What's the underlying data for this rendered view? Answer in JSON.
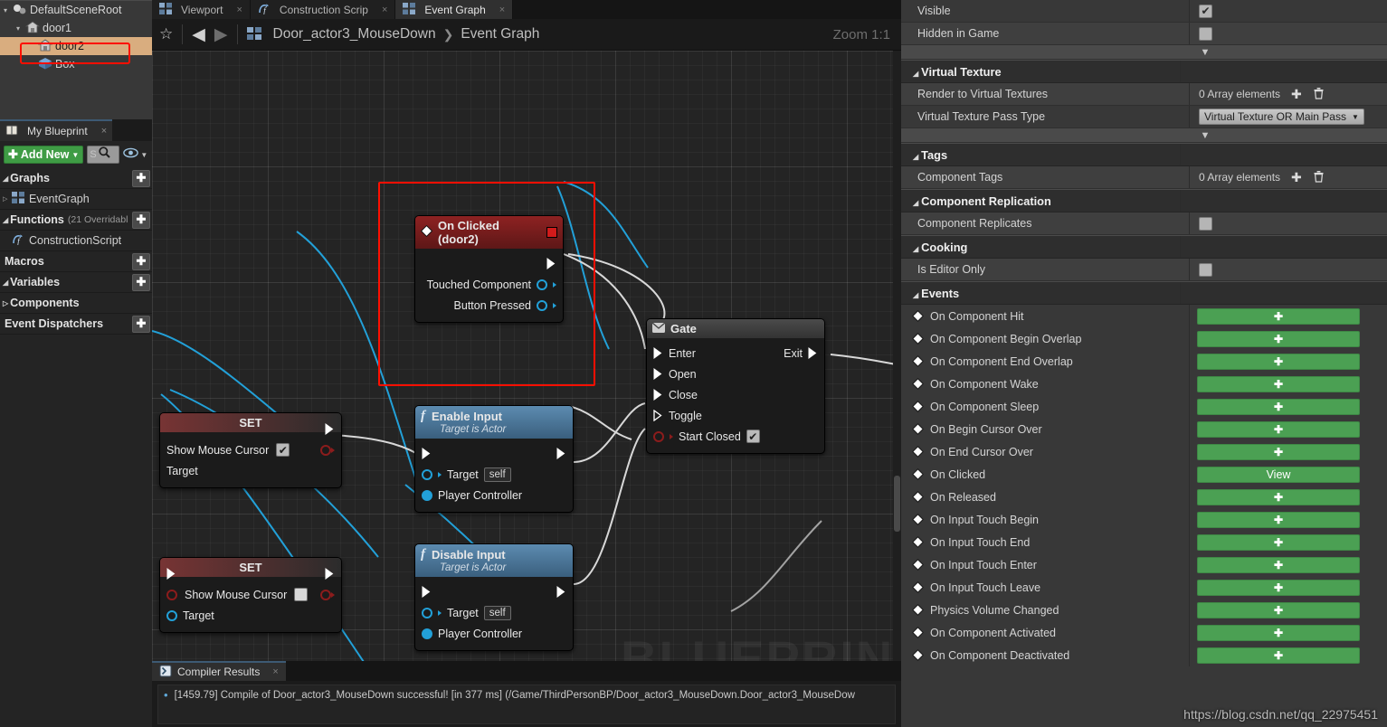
{
  "outliner": {
    "rows": [
      {
        "label": "DefaultSceneRoot",
        "icon": "scene-root-icon",
        "indent": 10,
        "expander": "▾",
        "selected": false
      },
      {
        "label": "door1",
        "icon": "mesh-icon",
        "indent": 24,
        "expander": "▾",
        "selected": false
      },
      {
        "label": "door2",
        "icon": "mesh-icon",
        "indent": 38,
        "expander": "",
        "selected": true
      },
      {
        "label": "Box",
        "icon": "box-icon",
        "indent": 38,
        "expander": "",
        "selected": false
      }
    ]
  },
  "my_blueprint": {
    "tab_label": "My Blueprint",
    "tab_close": "×",
    "add_new_label": "Add New",
    "add_new_plus": "✚",
    "add_new_caret": "▼",
    "search_placeholder": "S",
    "search_icon": "magnifier-icon",
    "eye_icon": "eye-icon",
    "eye_caret": "▼",
    "sections": [
      {
        "label": "Graphs",
        "expander": "◢",
        "add": "✚",
        "sub": "",
        "type": "section"
      },
      {
        "label": "EventGraph",
        "expander": "▷",
        "icon": "graph-icon",
        "type": "item"
      },
      {
        "label": "Functions",
        "expander": "◢",
        "add": "✚",
        "sub": "(21 Overridabl",
        "type": "section"
      },
      {
        "label": "ConstructionScript",
        "expander": "",
        "icon": "function-icon",
        "type": "item"
      },
      {
        "label": "Macros",
        "expander": "",
        "add": "✚",
        "sub": "",
        "type": "section"
      },
      {
        "label": "Variables",
        "expander": "◢",
        "add": "✚",
        "sub": "",
        "type": "section"
      },
      {
        "label": "Components",
        "expander": "▷",
        "add": "",
        "sub": "",
        "type": "section"
      },
      {
        "label": "Event Dispatchers",
        "expander": "",
        "add": "✚",
        "sub": "",
        "type": "section"
      }
    ]
  },
  "doc_tabs": [
    {
      "label": "Viewport",
      "icon": "viewport-icon",
      "active": false,
      "close": "×"
    },
    {
      "label": "Construction Scrip",
      "icon": "function-icon",
      "active": false,
      "close": "×"
    },
    {
      "label": "Event Graph",
      "icon": "graph-icon",
      "active": true,
      "close": "×"
    }
  ],
  "graph_toolbar": {
    "star_icon": "☆",
    "back_icon": "◀",
    "forward_icon": "▶",
    "breadcrumb_icon": "graph-icon",
    "breadcrumb_root": "Door_actor3_MouseDown",
    "breadcrumb_sep": "❯",
    "breadcrumb_leaf": "Event Graph",
    "zoom_label": "Zoom 1:1"
  },
  "graph": {
    "watermark": "BLUEPRINT",
    "nodes": {
      "on_clicked": {
        "title": "On Clicked (door2)",
        "pins": [
          "Touched Component",
          "Button Pressed"
        ]
      },
      "gate": {
        "title": "Gate",
        "inputs": [
          "Enter",
          "Open",
          "Close",
          "Toggle"
        ],
        "output": "Exit",
        "option_label": "Start Closed",
        "option_checked": true
      },
      "set_top": {
        "title": "SET",
        "bool_label": "Show Mouse Cursor",
        "bool_checked": true,
        "target_label": "Target"
      },
      "set_bottom": {
        "title": "SET",
        "bool_label": "Show Mouse Cursor",
        "bool_checked": false,
        "target_label": "Target"
      },
      "enable_input": {
        "title": "Enable Input",
        "subtitle": "Target is Actor",
        "target_label": "Target",
        "target_value": "self",
        "player_controller_label": "Player Controller"
      },
      "disable_input": {
        "title": "Disable Input",
        "subtitle": "Target is Actor",
        "target_label": "Target",
        "target_value": "self",
        "player_controller_label": "Player Controller"
      }
    }
  },
  "compiler": {
    "tab_label": "Compiler Results",
    "tab_icon": "compiler-icon",
    "tab_close": "×",
    "bullet": "•",
    "message": "[1459.79] Compile of Door_actor3_MouseDown successful! [in 377 ms] (/Game/ThirdPersonBP/Door_actor3_MouseDown.Door_actor3_MouseDow"
  },
  "details": {
    "top_rows": [
      {
        "label": "Visible",
        "type": "checkbox",
        "checked": true,
        "alt": false
      },
      {
        "label": "Hidden in Game",
        "type": "checkbox",
        "checked": false,
        "alt": true
      }
    ],
    "sections": [
      {
        "title": "Virtual Texture",
        "rows": [
          {
            "label": "Render to Virtual Textures",
            "type": "array",
            "value": "0 Array elements",
            "add": "✚",
            "delete": "🗑",
            "alt": true
          },
          {
            "label": "Virtual Texture Pass Type",
            "type": "combo",
            "value": "Virtual Texture OR Main Pass",
            "caret": "▼",
            "alt": false
          }
        ],
        "trailing_separator": true
      },
      {
        "title": "Tags",
        "rows": [
          {
            "label": "Component Tags",
            "type": "array",
            "value": "0 Array elements",
            "add": "✚",
            "delete": "🗑",
            "alt": true
          }
        ],
        "trailing_separator": false
      },
      {
        "title": "Component Replication",
        "rows": [
          {
            "label": "Component Replicates",
            "type": "checkbox",
            "checked": false,
            "alt": true
          }
        ],
        "trailing_separator": false
      },
      {
        "title": "Cooking",
        "rows": [
          {
            "label": "Is Editor Only",
            "type": "checkbox",
            "checked": false,
            "alt": true
          }
        ],
        "trailing_separator": false
      }
    ],
    "events_section_title": "Events",
    "events": [
      {
        "label": "On Component Hit",
        "button": "✚",
        "mode": "add",
        "highlighted": false
      },
      {
        "label": "On Component Begin Overlap",
        "button": "✚",
        "mode": "add",
        "highlighted": false
      },
      {
        "label": "On Component End Overlap",
        "button": "✚",
        "mode": "add",
        "highlighted": false
      },
      {
        "label": "On Component Wake",
        "button": "✚",
        "mode": "add",
        "highlighted": false
      },
      {
        "label": "On Component Sleep",
        "button": "✚",
        "mode": "add",
        "highlighted": false
      },
      {
        "label": "On Begin Cursor Over",
        "button": "✚",
        "mode": "add",
        "highlighted": false
      },
      {
        "label": "On End Cursor Over",
        "button": "✚",
        "mode": "add",
        "highlighted": false
      },
      {
        "label": "On Clicked",
        "button": "View",
        "mode": "view",
        "highlighted": true
      },
      {
        "label": "On Released",
        "button": "✚",
        "mode": "add",
        "highlighted": false
      },
      {
        "label": "On Input Touch Begin",
        "button": "✚",
        "mode": "add",
        "highlighted": false
      },
      {
        "label": "On Input Touch End",
        "button": "✚",
        "mode": "add",
        "highlighted": false
      },
      {
        "label": "On Input Touch Enter",
        "button": "✚",
        "mode": "add",
        "highlighted": false
      },
      {
        "label": "On Input Touch Leave",
        "button": "✚",
        "mode": "add",
        "highlighted": false
      },
      {
        "label": "Physics Volume Changed",
        "button": "✚",
        "mode": "add",
        "highlighted": false
      },
      {
        "label": "On Component Activated",
        "button": "✚",
        "mode": "add",
        "highlighted": false
      },
      {
        "label": "On Component Deactivated",
        "button": "✚",
        "mode": "add",
        "highlighted": false
      }
    ]
  },
  "watermark_url": "https://blog.csdn.net/qq_22975451",
  "colors": {
    "accent_green": "#4ba053",
    "highlight_red": "#ff0f00",
    "selection_tan": "#d9ad7f",
    "exec_wire": "#d8d8d8",
    "object_wire": "#22a0d8"
  }
}
